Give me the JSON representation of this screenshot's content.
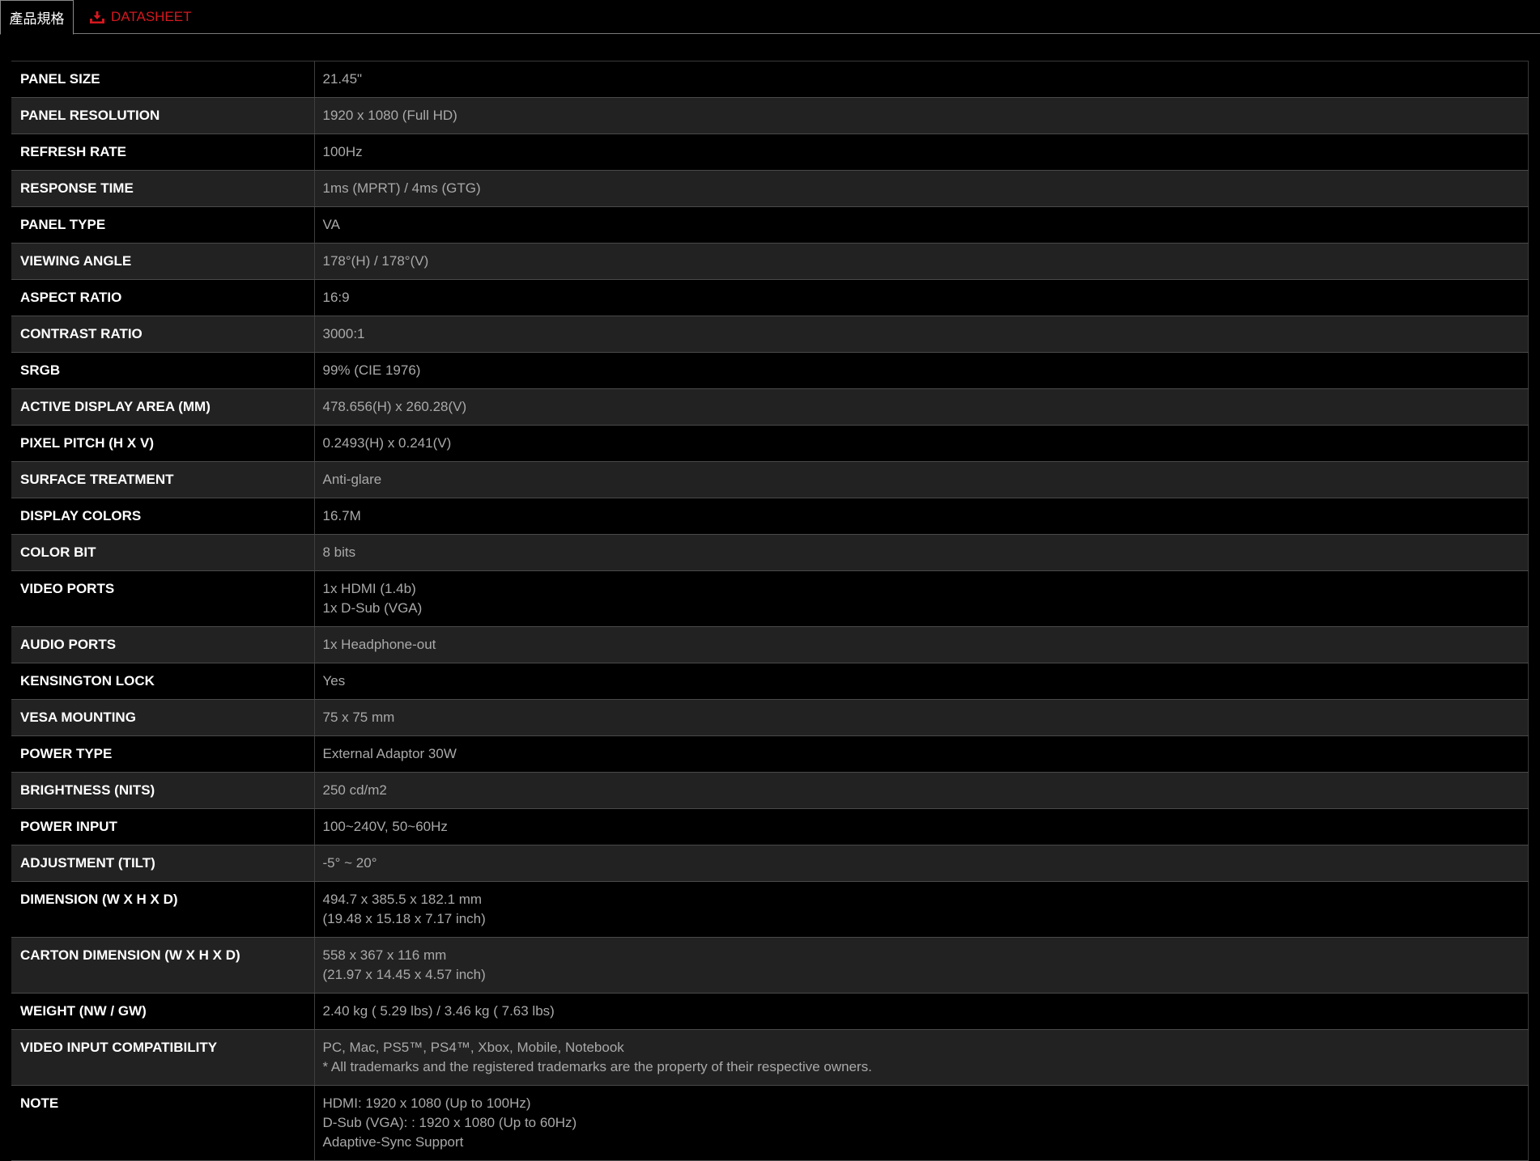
{
  "tabs": {
    "specs_label": "產品規格",
    "datasheet_label": "DATASHEET"
  },
  "colors": {
    "accent": "#d4181f",
    "row_alt": "#222222",
    "label_text": "#ffffff",
    "value_text": "#a9a9a9"
  },
  "specs": [
    {
      "label": "PANEL SIZE",
      "value": [
        "21.45\""
      ]
    },
    {
      "label": "PANEL RESOLUTION",
      "value": [
        "1920 x 1080 (Full HD)"
      ]
    },
    {
      "label": "REFRESH RATE",
      "value": [
        "100Hz"
      ]
    },
    {
      "label": "RESPONSE TIME",
      "value": [
        "1ms (MPRT) / 4ms (GTG)"
      ]
    },
    {
      "label": "PANEL TYPE",
      "value": [
        "VA"
      ]
    },
    {
      "label": "VIEWING ANGLE",
      "value": [
        "178°(H) / 178°(V)"
      ]
    },
    {
      "label": "ASPECT RATIO",
      "value": [
        "16:9"
      ]
    },
    {
      "label": "CONTRAST RATIO",
      "value": [
        "3000:1"
      ]
    },
    {
      "label": "SRGB",
      "value": [
        "99% (CIE 1976)"
      ]
    },
    {
      "label": "ACTIVE DISPLAY AREA (MM)",
      "value": [
        "478.656(H) x 260.28(V)"
      ]
    },
    {
      "label": "PIXEL PITCH (H X V)",
      "value": [
        "0.2493(H) x 0.241(V)"
      ]
    },
    {
      "label": "SURFACE TREATMENT",
      "value": [
        "Anti-glare"
      ]
    },
    {
      "label": "DISPLAY COLORS",
      "value": [
        "16.7M"
      ]
    },
    {
      "label": "COLOR BIT",
      "value": [
        "8 bits"
      ]
    },
    {
      "label": "VIDEO PORTS",
      "value": [
        "1x HDMI (1.4b)",
        "1x D-Sub (VGA)"
      ]
    },
    {
      "label": "AUDIO PORTS",
      "value": [
        "1x Headphone-out"
      ]
    },
    {
      "label": "KENSINGTON LOCK",
      "value": [
        "Yes"
      ]
    },
    {
      "label": "VESA MOUNTING",
      "value": [
        "75 x 75 mm"
      ]
    },
    {
      "label": "POWER TYPE",
      "value": [
        "External Adaptor 30W"
      ]
    },
    {
      "label": "BRIGHTNESS (NITS)",
      "value": [
        "250 cd/m2"
      ]
    },
    {
      "label": "POWER INPUT",
      "value": [
        "100~240V, 50~60Hz"
      ]
    },
    {
      "label": "ADJUSTMENT (TILT)",
      "value": [
        "-5° ~ 20°"
      ]
    },
    {
      "label": "DIMENSION (W X H X D)",
      "value": [
        "494.7 x 385.5 x 182.1 mm",
        "(19.48 x 15.18 x 7.17 inch)"
      ]
    },
    {
      "label": "CARTON DIMENSION (W X H X D)",
      "value": [
        "558 x 367 x 116 mm",
        "(21.97 x 14.45 x 4.57 inch)"
      ]
    },
    {
      "label": "WEIGHT (NW / GW)",
      "value": [
        "2.40 kg ( 5.29 lbs) / 3.46 kg ( 7.63 lbs)"
      ]
    },
    {
      "label": "VIDEO INPUT COMPATIBILITY",
      "value": [
        "PC, Mac, PS5™, PS4™, Xbox, Mobile, Notebook",
        "* All trademarks and the registered trademarks are the property of their respective owners."
      ]
    },
    {
      "label": "NOTE",
      "value": [
        "HDMI: 1920 x 1080 (Up to 100Hz)",
        "D-Sub (VGA): : 1920 x 1080 (Up to 60Hz)",
        "Adaptive-Sync Support"
      ]
    }
  ]
}
